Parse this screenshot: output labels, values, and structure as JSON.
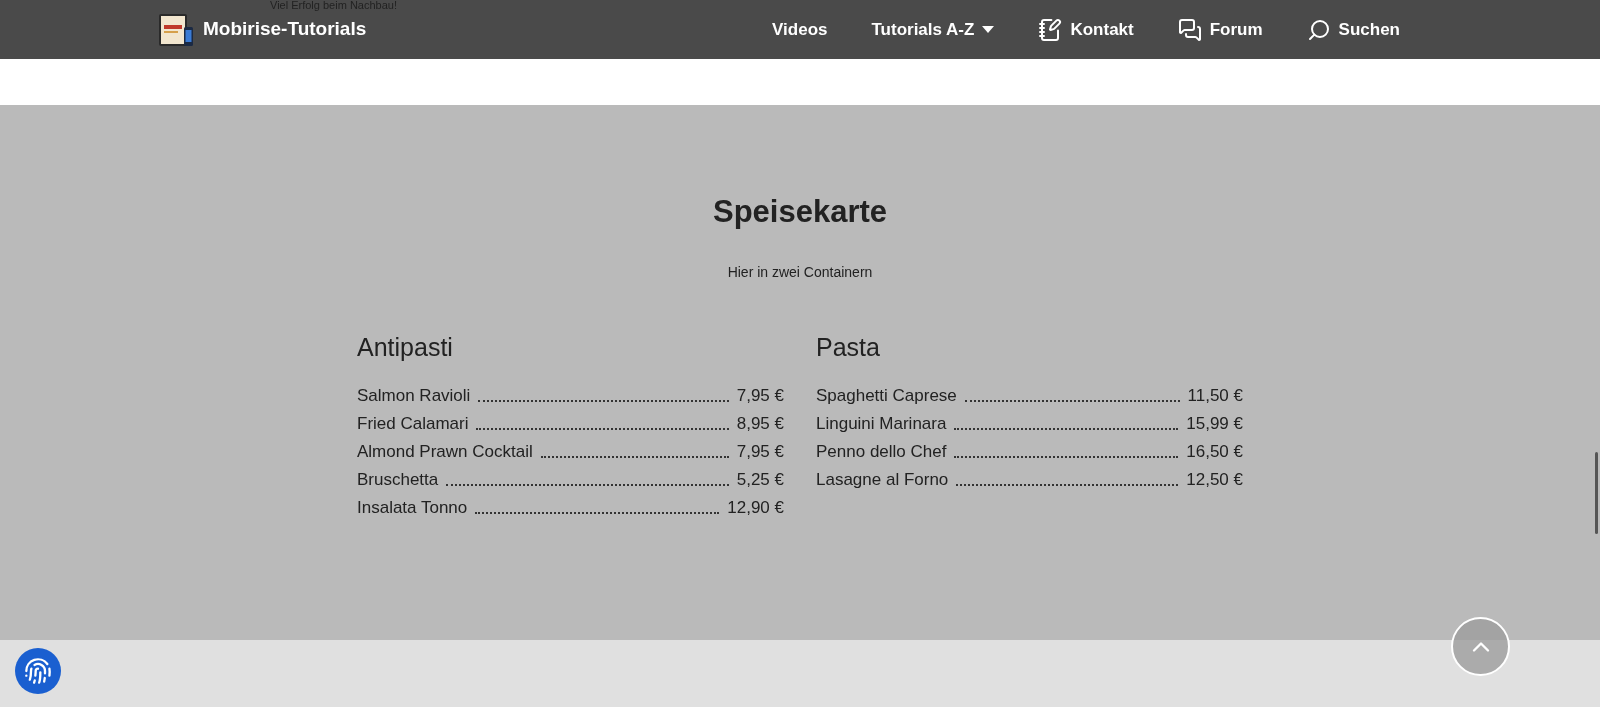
{
  "page_above_text": "Viel Erfolg beim Nachbau!",
  "navbar": {
    "brand": "Mobirise-Tutorials",
    "links": [
      {
        "label": "Videos",
        "kind": "plain"
      },
      {
        "label": "Tutorials A-Z",
        "kind": "dropdown"
      },
      {
        "label": "Kontakt",
        "kind": "contact"
      },
      {
        "label": "Forum",
        "kind": "forum"
      },
      {
        "label": "Suchen",
        "kind": "search"
      }
    ]
  },
  "menu": {
    "title": "Speisekarte",
    "subtitle": "Hier in zwei Containern",
    "sections": [
      {
        "heading": "Antipasti",
        "items": [
          {
            "name": "Salmon Ravioli",
            "price": "7,95 €"
          },
          {
            "name": "Fried Calamari",
            "price": "8,95 €"
          },
          {
            "name": "Almond Prawn Cocktail",
            "price": "7,95 €"
          },
          {
            "name": "Bruschetta",
            "price": "5,25 €"
          },
          {
            "name": "Insalata Tonno",
            "price": "12,90 €"
          }
        ]
      },
      {
        "heading": "Pasta",
        "items": [
          {
            "name": "Spaghetti Caprese",
            "price": "11,50 €"
          },
          {
            "name": "Linguini Marinara",
            "price": "15,99 €"
          },
          {
            "name": "Penno dello Chef",
            "price": "16,50 €"
          },
          {
            "name": "Lasagne al Forno",
            "price": "12,50 €"
          }
        ]
      }
    ]
  }
}
